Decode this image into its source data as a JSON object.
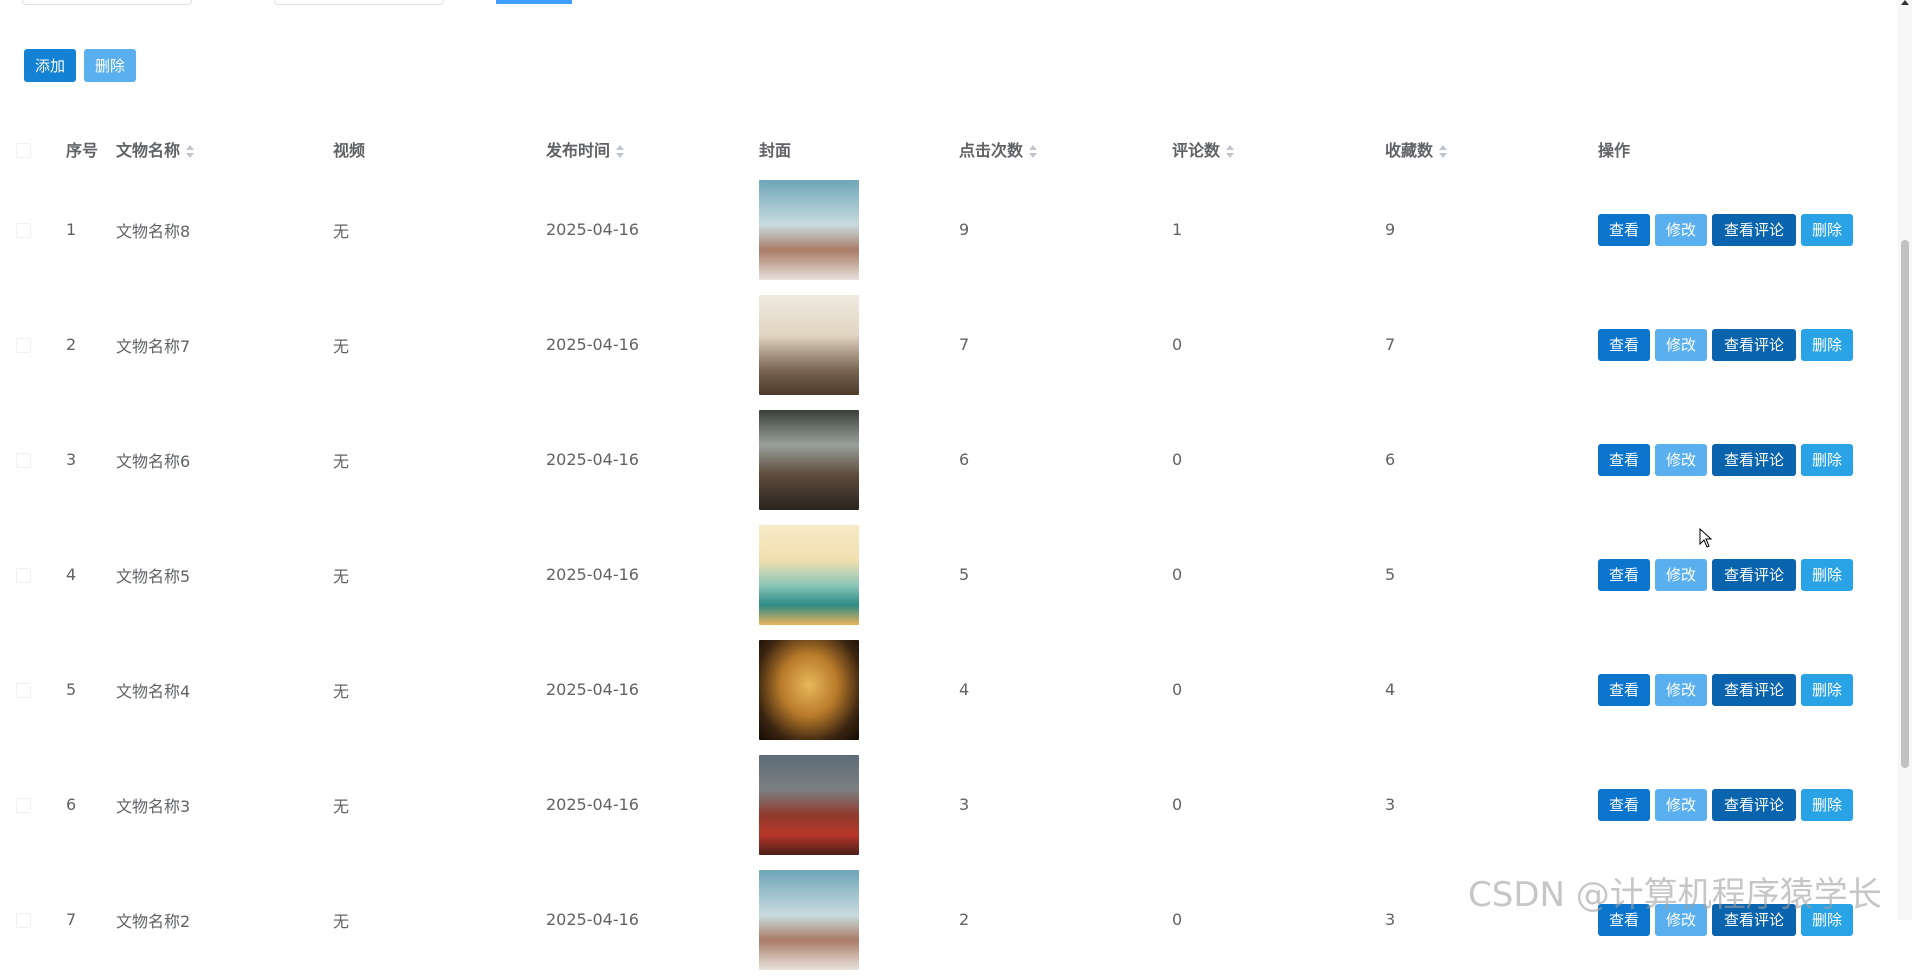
{
  "toolbar": {
    "add_label": "添加",
    "delete_label": "删除"
  },
  "table": {
    "headers": {
      "index": "序号",
      "name": "文物名称",
      "video": "视频",
      "publish_time": "发布时间",
      "cover": "封面",
      "clicks": "点击次数",
      "comments": "评论数",
      "favorites": "收藏数",
      "actions": "操作"
    },
    "rows": [
      {
        "index": "1",
        "name": "文物名称8",
        "video": "无",
        "date": "2025-04-16",
        "clicks": "9",
        "comments": "1",
        "favorites": "9"
      },
      {
        "index": "2",
        "name": "文物名称7",
        "video": "无",
        "date": "2025-04-16",
        "clicks": "7",
        "comments": "0",
        "favorites": "7"
      },
      {
        "index": "3",
        "name": "文物名称6",
        "video": "无",
        "date": "2025-04-16",
        "clicks": "6",
        "comments": "0",
        "favorites": "6"
      },
      {
        "index": "4",
        "name": "文物名称5",
        "video": "无",
        "date": "2025-04-16",
        "clicks": "5",
        "comments": "0",
        "favorites": "5"
      },
      {
        "index": "5",
        "name": "文物名称4",
        "video": "无",
        "date": "2025-04-16",
        "clicks": "4",
        "comments": "0",
        "favorites": "4"
      },
      {
        "index": "6",
        "name": "文物名称3",
        "video": "无",
        "date": "2025-04-16",
        "clicks": "3",
        "comments": "0",
        "favorites": "3"
      },
      {
        "index": "7",
        "name": "文物名称2",
        "video": "无",
        "date": "2025-04-16",
        "clicks": "2",
        "comments": "0",
        "favorites": "3"
      }
    ]
  },
  "row_actions": {
    "view": "查看",
    "edit": "修改",
    "view_comments": "查看评论",
    "delete": "删除"
  },
  "watermark": "CSDN @计算机程序猿学长",
  "colors": {
    "primary": "#1381d4",
    "light": "#5aafee",
    "dark": "#0a63ad"
  }
}
